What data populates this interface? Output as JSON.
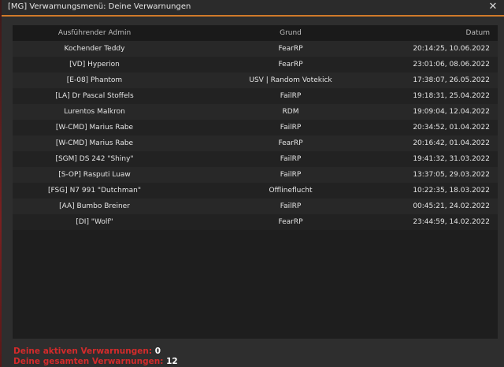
{
  "window": {
    "title": "[MG] Verwarnungsmenü: Deine Verwarnungen",
    "close_label": "✕"
  },
  "table": {
    "columns": [
      "Ausführender Admin",
      "Grund",
      "Datum"
    ],
    "rows": [
      {
        "admin": "Kochender Teddy",
        "reason": "FearRP",
        "date": "20:14:25, 10.06.2022"
      },
      {
        "admin": "[VD] Hyperion",
        "reason": "FearRP",
        "date": "23:01:06, 08.06.2022"
      },
      {
        "admin": "[E-08] Phantom",
        "reason": "USV | Random Votekick",
        "date": "17:38:07, 26.05.2022"
      },
      {
        "admin": "[LA] Dr Pascal Stoffels",
        "reason": "FailRP",
        "date": "19:18:31, 25.04.2022"
      },
      {
        "admin": "Lurentos Malkron",
        "reason": "RDM",
        "date": "19:09:04, 12.04.2022"
      },
      {
        "admin": "[W-CMD] Marius Rabe",
        "reason": "FailRP",
        "date": "20:34:52, 01.04.2022"
      },
      {
        "admin": "[W-CMD] Marius Rabe",
        "reason": "FearRP",
        "date": "20:16:42, 01.04.2022"
      },
      {
        "admin": "[SGM] DS 242 \"Shiny\"",
        "reason": "FailRP",
        "date": "19:41:32, 31.03.2022"
      },
      {
        "admin": "[S-OP] Rasputi Luaw",
        "reason": "FailRP",
        "date": "13:37:05, 29.03.2022"
      },
      {
        "admin": "[FSG] N7 991 \"Dutchman\"",
        "reason": "Offlineflucht",
        "date": "10:22:35, 18.03.2022"
      },
      {
        "admin": "[AA] Bumbo Breiner",
        "reason": "FailRP",
        "date": "00:45:21, 24.02.2022"
      },
      {
        "admin": "[DI] \"Wolf\"",
        "reason": "FearRP",
        "date": "23:44:59, 14.02.2022"
      }
    ]
  },
  "footer": {
    "active_label": "Deine aktiven Verwarnungen:",
    "active_value": "0",
    "total_label": "Deine gesamten Verwarnungen:",
    "total_value": "12"
  },
  "colors": {
    "accent": "#d07a2a",
    "footer_label": "#d32b2b"
  }
}
